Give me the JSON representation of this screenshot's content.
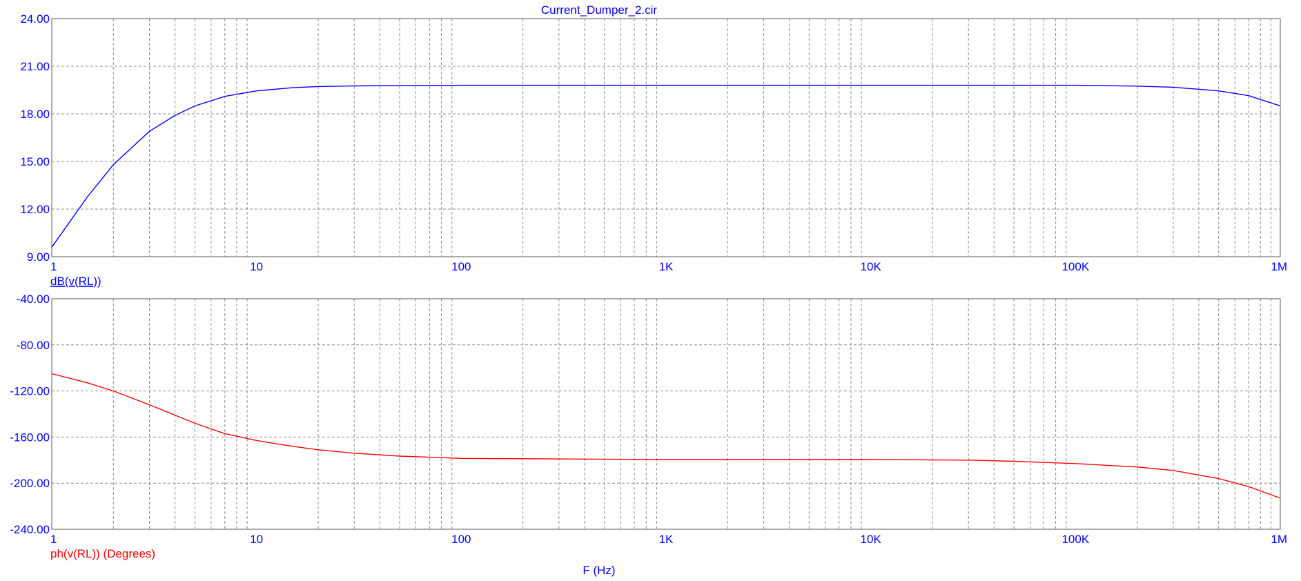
{
  "title": "Current_Dumper_2.cir",
  "xlabel": "F (Hz)",
  "colors": {
    "magnitude": "#0000ff",
    "phase": "#ff0000",
    "axis_text": "#0000ff",
    "grid": "#8c8c8c",
    "frame": "#5a5a5a"
  },
  "chart_data": [
    {
      "type": "line",
      "x_scale": "log",
      "xlim": [
        1,
        1000000
      ],
      "ylim": [
        9,
        24
      ],
      "grid": true,
      "x_ticks": [
        1,
        10,
        100,
        1000,
        10000,
        100000,
        1000000
      ],
      "x_tick_labels": [
        "1",
        "10",
        "100",
        "1K",
        "10K",
        "100K",
        "1M"
      ],
      "y_ticks": [
        9,
        12,
        15,
        18,
        21,
        24
      ],
      "y_tick_labels": [
        "9.00",
        "12.00",
        "15.00",
        "18.00",
        "21.00",
        "24.00"
      ],
      "series": [
        {
          "name": "dB(v(RL))",
          "color": "#0000ff",
          "x": [
            1,
            1.5,
            2,
            3,
            4,
            5,
            7,
            10,
            15,
            20,
            30,
            50,
            100,
            1000,
            10000,
            100000,
            200000,
            300000,
            500000,
            700000,
            1000000
          ],
          "y": [
            9.6,
            12.8,
            14.8,
            16.9,
            17.9,
            18.5,
            19.1,
            19.45,
            19.65,
            19.72,
            19.76,
            19.78,
            19.8,
            19.8,
            19.8,
            19.8,
            19.75,
            19.68,
            19.45,
            19.15,
            18.5
          ]
        }
      ]
    },
    {
      "type": "line",
      "x_scale": "log",
      "xlim": [
        1,
        1000000
      ],
      "ylim": [
        -240,
        -40
      ],
      "grid": true,
      "x_ticks": [
        1,
        10,
        100,
        1000,
        10000,
        100000,
        1000000
      ],
      "x_tick_labels": [
        "1",
        "10",
        "100",
        "1K",
        "10K",
        "100K",
        "1M"
      ],
      "y_ticks": [
        -240,
        -200,
        -160,
        -120,
        -80,
        -40
      ],
      "y_tick_labels": [
        "-240.00",
        "-200.00",
        "-160.00",
        "-120.00",
        "-80.00",
        "-40.00"
      ],
      "series": [
        {
          "name": "ph(v(RL)) (Degrees)",
          "color": "#ff0000",
          "x": [
            1,
            1.5,
            2,
            3,
            4,
            5,
            7,
            10,
            15,
            20,
            30,
            50,
            100,
            1000,
            10000,
            30000,
            50000,
            100000,
            200000,
            300000,
            500000,
            700000,
            1000000
          ],
          "y": [
            -105,
            -113,
            -120,
            -132,
            -141,
            -148,
            -157,
            -163,
            -168,
            -171,
            -174,
            -176.5,
            -178.5,
            -179.5,
            -179.5,
            -180,
            -181,
            -183,
            -186,
            -189,
            -196,
            -203,
            -213
          ]
        }
      ]
    }
  ]
}
